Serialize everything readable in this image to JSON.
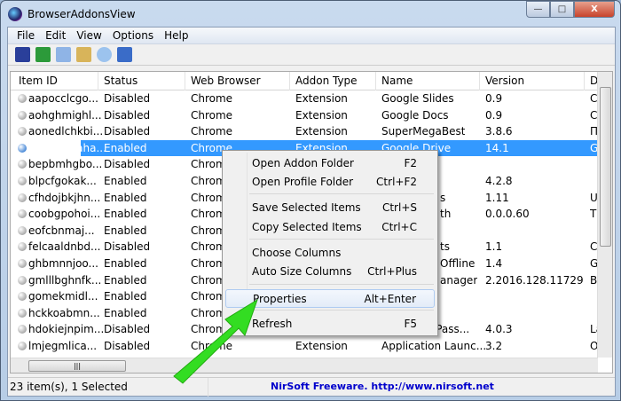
{
  "window": {
    "title": "BrowserAddonsView",
    "controls": {
      "minimize": "—",
      "maximize": "□",
      "close": "X"
    }
  },
  "menubar": [
    "File",
    "Edit",
    "View",
    "Options",
    "Help"
  ],
  "toolbar": [
    "save-icon",
    "refresh-icon",
    "copy-icon",
    "properties-icon",
    "find-icon",
    "exit-icon"
  ],
  "columns": [
    "Item ID",
    "Status",
    "Web Browser",
    "Addon Type",
    "Name",
    "Version",
    "De"
  ],
  "rows": [
    [
      "aapocclcgo...",
      "Disabled",
      "Chrome",
      "Extension",
      "Google Slides",
      "0.9",
      "Cr"
    ],
    [
      "aohghmighl...",
      "Disabled",
      "Chrome",
      "Extension",
      "Google Docs",
      "0.9",
      "Cr"
    ],
    [
      "aonedlchkbi...",
      "Disabled",
      "Chrome",
      "Extension",
      "SuperMegaBest",
      "3.8.6",
      "Пр"
    ],
    [
      "apdfllckaaha...",
      "Enabled",
      "Chrome",
      "Extension",
      "Google Drive",
      "14.1",
      "Go"
    ],
    [
      "bepbmhgbo...",
      "Disabled",
      "Chrome",
      "",
      "",
      "",
      ""
    ],
    [
      "blpcfgokak...",
      "Enabled",
      "Chrome",
      "",
      "",
      "4.2.8",
      ""
    ],
    [
      "cfhdojbkjhn...",
      "Enabled",
      "Chrome",
      "",
      "s",
      "1.11",
      "Us"
    ],
    [
      "coobgpohoi...",
      "Enabled",
      "Chrome",
      "",
      "th",
      "0.0.0.60",
      "Th"
    ],
    [
      "eofcbnmaj...",
      "Enabled",
      "Chrome",
      "",
      "",
      "",
      ""
    ],
    [
      "felcaaldnbd...",
      "Disabled",
      "Chrome",
      "",
      "ts",
      "1.1",
      "Cr"
    ],
    [
      "ghbmnnjoo...",
      "Enabled",
      "Chrome",
      "",
      "Offline",
      "1.4",
      "Ge"
    ],
    [
      "gmlllbghnfk...",
      "Enabled",
      "Chrome",
      "",
      "anager",
      "2.2016.128.11729",
      "Bo"
    ],
    [
      "gomekmidl...",
      "Enabled",
      "Chrome",
      "",
      "",
      "",
      ""
    ],
    [
      "hckkoabmn...",
      "Enabled",
      "Chrome",
      "",
      "",
      "",
      ""
    ],
    [
      "hdokiejnpim...",
      "Disabled",
      "Chrome",
      "",
      "e Pass...",
      "4.0.3",
      "La"
    ],
    [
      "lmjegmlica...",
      "Disabled",
      "Chrome",
      "Extension",
      "Application Launc...",
      "3.2",
      "Op"
    ]
  ],
  "selected_index": 3,
  "context_menu": [
    {
      "label": "Open Addon Folder",
      "shortcut": "F2"
    },
    {
      "label": "Open Profile Folder",
      "shortcut": "Ctrl+F2"
    },
    {
      "label": "Save Selected Items",
      "shortcut": "Ctrl+S"
    },
    {
      "label": "Copy Selected Items",
      "shortcut": "Ctrl+C"
    },
    {
      "label": "Choose Columns",
      "shortcut": ""
    },
    {
      "label": "Auto Size Columns",
      "shortcut": "Ctrl+Plus"
    },
    {
      "label": "Properties",
      "shortcut": "Alt+Enter"
    },
    {
      "label": "Refresh",
      "shortcut": "F5"
    }
  ],
  "status": {
    "count": "23 item(s), 1 Selected",
    "credit": "NirSoft Freeware.  http://www.nirsoft.net"
  },
  "colors": {
    "selection": "#3399ff",
    "arrow": "#33dd22",
    "link": "#0000cc"
  }
}
